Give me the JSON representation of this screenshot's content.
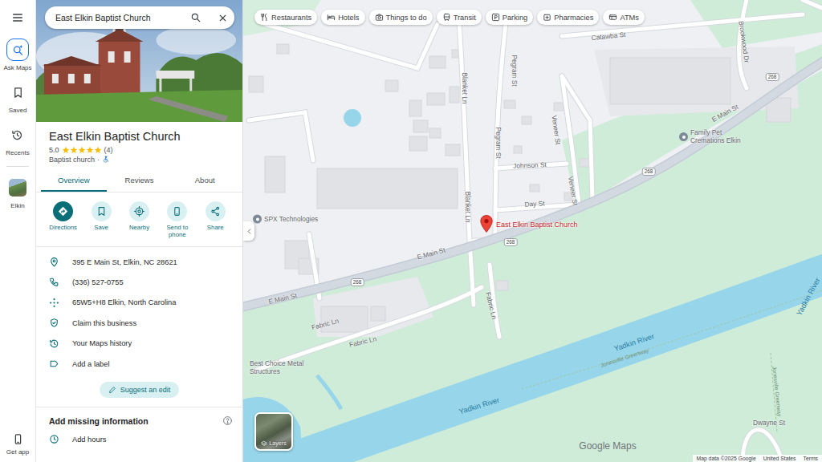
{
  "rail": {
    "items": [
      {
        "label": "Ask Maps",
        "kind": "ask",
        "selected": true
      },
      {
        "label": "Saved",
        "kind": "saved",
        "selected": false
      },
      {
        "label": "Recents",
        "kind": "recents",
        "selected": false
      },
      {
        "label": "Elkin",
        "kind": "place",
        "selected": false
      }
    ],
    "get_app": "Get app"
  },
  "search": {
    "value": "East Elkin Baptist Church"
  },
  "place": {
    "name": "East Elkin Baptist Church",
    "rating": "5.0",
    "stars": 5,
    "review_count": "(4)",
    "category": "Baptist church",
    "separator": "·",
    "wheelchair_accessible": true
  },
  "tabs": [
    {
      "label": "Overview",
      "selected": true
    },
    {
      "label": "Reviews",
      "selected": false
    },
    {
      "label": "About",
      "selected": false
    }
  ],
  "actions": [
    {
      "label": "Directions",
      "kind": "directions"
    },
    {
      "label": "Save",
      "kind": "save"
    },
    {
      "label": "Nearby",
      "kind": "nearby"
    },
    {
      "label": "Send to phone",
      "kind": "send"
    },
    {
      "label": "Share",
      "kind": "share"
    }
  ],
  "info": [
    {
      "text": "395 E Main St, Elkin, NC 28621",
      "kind": "address"
    },
    {
      "text": "(336) 527-0755",
      "kind": "phone"
    },
    {
      "text": "65W5+H8 Elkin, North Carolina",
      "kind": "pluscode"
    },
    {
      "text": "Claim this business",
      "kind": "claim"
    },
    {
      "text": "Your Maps history",
      "kind": "history"
    },
    {
      "text": "Add a label",
      "kind": "label"
    }
  ],
  "suggest_edit": "Suggest an edit",
  "missing": {
    "title": "Add missing information",
    "items": [
      {
        "text": "Add hours",
        "kind": "hours"
      }
    ]
  },
  "chips": [
    {
      "label": "Restaurants",
      "kind": "restaurants"
    },
    {
      "label": "Hotels",
      "kind": "hotels"
    },
    {
      "label": "Things to do",
      "kind": "things"
    },
    {
      "label": "Transit",
      "kind": "transit"
    },
    {
      "label": "Parking",
      "kind": "parking"
    },
    {
      "label": "Pharmacies",
      "kind": "pharmacy"
    },
    {
      "label": "ATMs",
      "kind": "atm"
    }
  ],
  "map": {
    "labels": [
      {
        "text": "Catawba St",
        "kind": "street"
      },
      {
        "text": "Pegram St",
        "kind": "street"
      },
      {
        "text": "Blanket Ln",
        "kind": "street"
      },
      {
        "text": "Pegram St",
        "kind": "street"
      },
      {
        "text": "Veneer St",
        "kind": "street"
      },
      {
        "text": "Johnson St",
        "kind": "street"
      },
      {
        "text": "Day St",
        "kind": "street"
      },
      {
        "text": "Blanket Ln",
        "kind": "street"
      },
      {
        "text": "Veneer St",
        "kind": "street"
      },
      {
        "text": "Brookwood Dr",
        "kind": "street"
      },
      {
        "text": "E Main St",
        "kind": "street"
      },
      {
        "text": "E Main St",
        "kind": "street"
      },
      {
        "text": "E Main St",
        "kind": "street"
      },
      {
        "text": "Fabric Ln",
        "kind": "street"
      },
      {
        "text": "Fabric Ln",
        "kind": "street"
      },
      {
        "text": "Fabric Ln",
        "kind": "street"
      },
      {
        "text": "Yadkin River",
        "kind": "water"
      },
      {
        "text": "Yadkin River",
        "kind": "water"
      },
      {
        "text": "Yadkin River",
        "kind": "water"
      },
      {
        "text": "Jonesville Greenway",
        "kind": "area"
      },
      {
        "text": "SPX Technologies",
        "kind": "poi"
      },
      {
        "text": "Family Pet Cremations Elkin",
        "kind": "poi"
      },
      {
        "text": "Best Choice Metal Structures",
        "kind": "place"
      },
      {
        "text": "Dwayne St",
        "kind": "street"
      },
      {
        "text": "Jonesville Greenway",
        "kind": "area"
      }
    ],
    "shields": [
      "268",
      "268",
      "268",
      "268"
    ],
    "pin": {
      "label": "East Elkin Baptist Church"
    }
  },
  "layers": "Layers",
  "watermark": "Google Maps",
  "footer": [
    "Map data ©2025 Google",
    "United States",
    "Terms"
  ]
}
